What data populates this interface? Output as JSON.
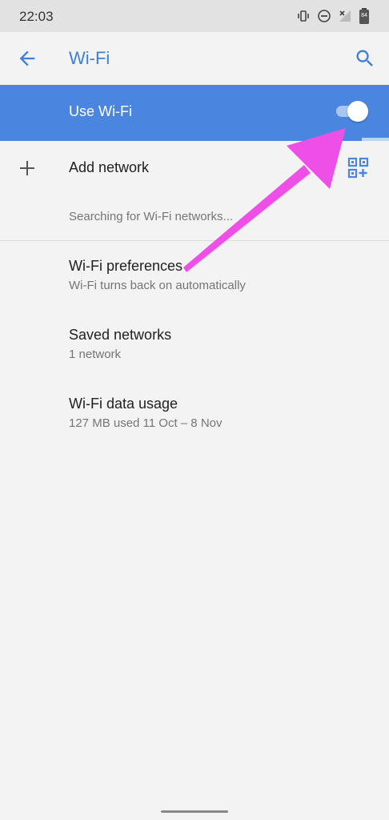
{
  "status_bar": {
    "time": "22:03",
    "icons": [
      "vibrate-icon",
      "do-not-disturb-icon",
      "no-signal-icon",
      "battery-icon"
    ],
    "battery_level": "84"
  },
  "app_bar": {
    "title": "Wi-Fi",
    "back_icon": "back-arrow-icon",
    "search_icon": "search-icon"
  },
  "wifi_toggle": {
    "label": "Use Wi-Fi",
    "state": "on",
    "scan_progress_percent": 93
  },
  "add_network": {
    "label": "Add network",
    "add_icon": "plus-icon",
    "qr_icon": "qr-code-add-icon"
  },
  "searching_text": "Searching for Wi-Fi networks...",
  "settings": [
    {
      "title": "Wi-Fi preferences",
      "subtitle": "Wi-Fi turns back on automatically"
    },
    {
      "title": "Saved networks",
      "subtitle": "1 network"
    },
    {
      "title": "Wi-Fi data usage",
      "subtitle": "127 MB used 11 Oct – 8 Nov"
    }
  ],
  "colors": {
    "accent": "#4a86e0",
    "title_blue": "#3d7fd9",
    "background": "#f3f3f3",
    "status_bar": "#e2e2e2",
    "annotation_arrow": "#ee4fe6"
  }
}
